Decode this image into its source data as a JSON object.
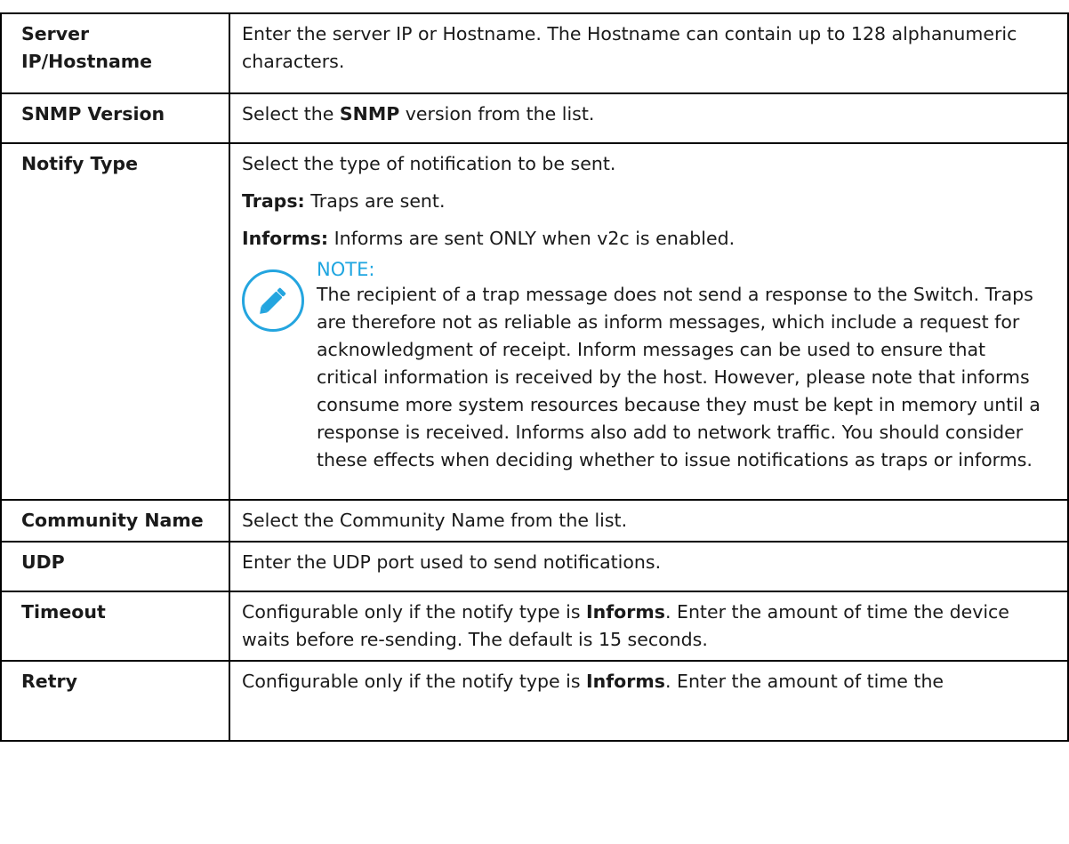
{
  "rows": [
    {
      "name": "Server IP/Hostname",
      "segments": [
        "Enter the server IP or Hostname. The Hostname can contain up to 128 alphanumeric characters."
      ]
    },
    {
      "name": "SNMP Version",
      "segments": [
        "Select the ",
        "SNMP",
        " version from the list."
      ]
    },
    {
      "name": "Notify Type",
      "intro": "Select the type of notification to be sent.",
      "traps_label": "Traps:",
      "traps_text": " Traps are sent.",
      "informs_label": "Informs:",
      "informs_text": " Informs are sent ONLY when v2c is enabled.",
      "note": {
        "title": "NOTE:",
        "icon": "pencil-icon",
        "text": "The recipient of a trap message does not send a response to the Switch. Traps are therefore not as reliable as inform messages, which include a request for acknowledgment of receipt. Inform messages can be used to ensure that critical information is received by the host. However, please note that informs consume more system resources because they must be kept in memory until a response is received. Informs also add to network traffic. You should consider these effects when deciding whether to issue notifications as traps or informs."
      }
    },
    {
      "name": "Community Name",
      "segments": [
        "Select the Community Name from the list."
      ]
    },
    {
      "name": "UDP",
      "segments": [
        "Enter the UDP port used to send notifications."
      ]
    },
    {
      "name": "Timeout",
      "segments": [
        "Configurable only if the notify type is ",
        "Informs",
        ". Enter the amount of time the device waits before re-sending. The default is 15 seconds."
      ]
    },
    {
      "name": "Retry",
      "segments": [
        "Configurable only if the notify type is ",
        "Informs",
        ". Enter the amount of time the"
      ]
    }
  ],
  "colors": {
    "note_accent": "#24a5df",
    "border": "#000000"
  }
}
